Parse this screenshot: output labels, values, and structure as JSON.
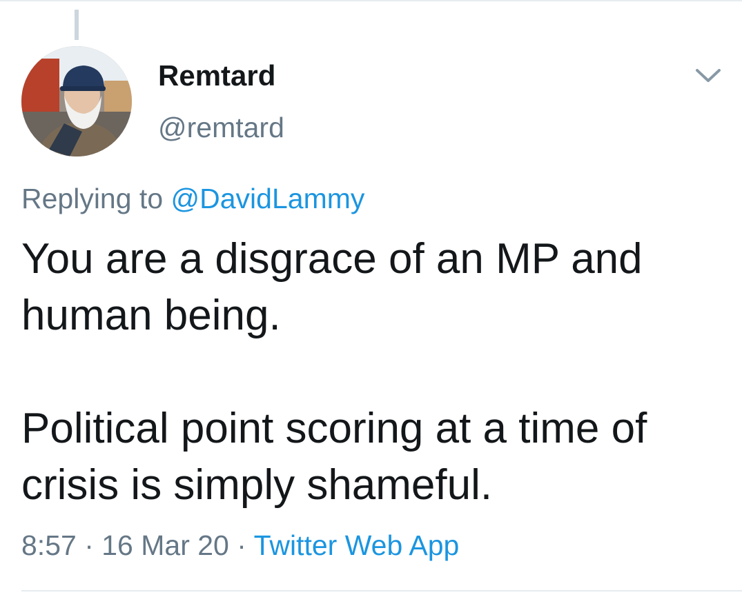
{
  "tweet": {
    "author": {
      "display_name": "Remtard",
      "handle": "@remtard"
    },
    "reply": {
      "prefix": "Replying to ",
      "to_handle": "@DavidLammy"
    },
    "text_lines": [
      "You are a disgrace of an MP and",
      "human being.",
      "Political point scoring at a time of",
      "crisis is simply shameful."
    ],
    "meta": {
      "time": "8:57",
      "separator": " · ",
      "date": "16 Mar 20",
      "source": "Twitter Web App"
    }
  },
  "icons": {
    "menu": "chevron-down-icon"
  },
  "colors": {
    "primary_text": "#14171a",
    "secondary_text": "#657786",
    "link": "#1b95e0",
    "divider": "#e6ecf0"
  }
}
